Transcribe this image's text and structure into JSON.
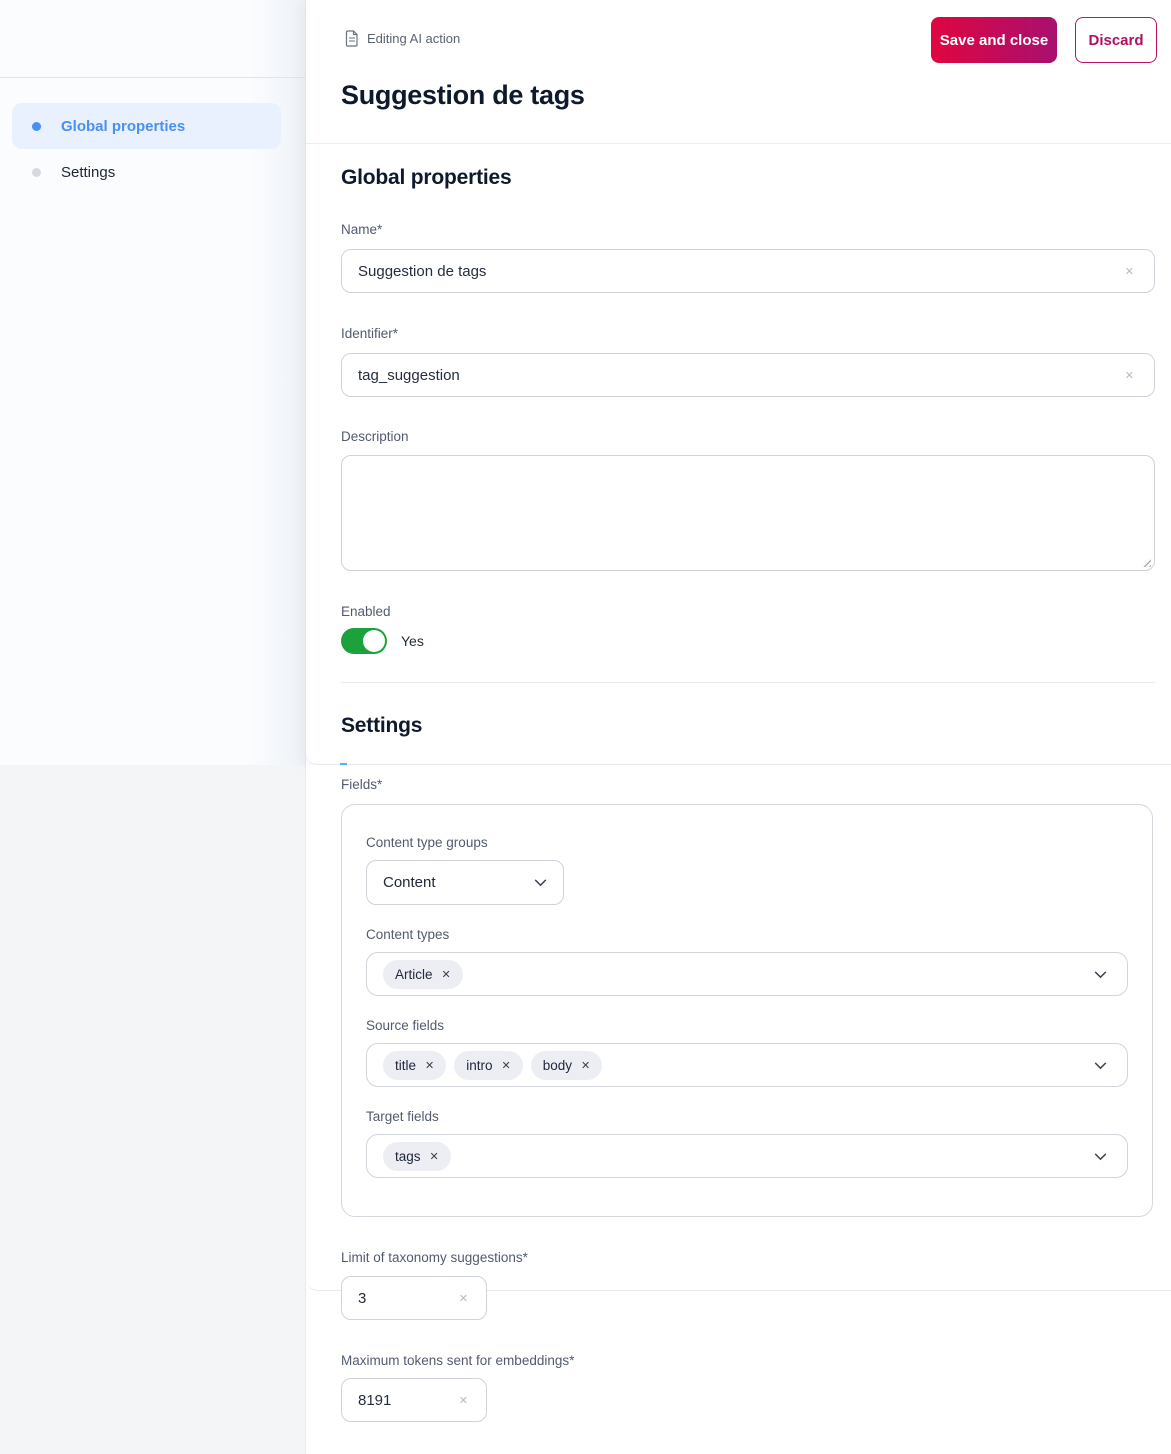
{
  "colors": {
    "accent_blue": "#4a90f2",
    "brand_gradient_start": "#e00540",
    "brand_gradient_end": "#a81070",
    "discard_crimson": "#b01060",
    "toggle_green": "#1ba23c",
    "active_nav_bg": "#e8f1fd",
    "pill_bg": "#edeef4"
  },
  "icons": {
    "clear": "✕",
    "remove_tag": "✕"
  },
  "sidebar": {
    "items": [
      {
        "label": "Global properties",
        "active": true
      },
      {
        "label": "Settings",
        "active": false
      }
    ]
  },
  "header": {
    "context_label": "Editing AI action",
    "save_label": "Save and close",
    "discard_label": "Discard"
  },
  "page": {
    "title": "Suggestion de tags"
  },
  "global_properties": {
    "heading": "Global properties",
    "name": {
      "label": "Name*",
      "value": "Suggestion de tags"
    },
    "identifier": {
      "label": "Identifier*",
      "value": "tag_suggestion"
    },
    "description": {
      "label": "Description",
      "value": ""
    },
    "enabled": {
      "label": "Enabled",
      "state_label": "Yes",
      "on": true
    }
  },
  "settings": {
    "heading": "Settings",
    "fields_label": "Fields*",
    "content_type_groups": {
      "label": "Content type groups",
      "selected": "Content"
    },
    "content_types": {
      "label": "Content types",
      "tags": [
        "Article"
      ]
    },
    "source_fields": {
      "label": "Source fields",
      "tags": [
        "title",
        "intro",
        "body"
      ]
    },
    "target_fields": {
      "label": "Target fields",
      "tags": [
        "tags"
      ]
    },
    "limit": {
      "label": "Limit of taxonomy suggestions*",
      "value": "3"
    },
    "max_tokens": {
      "label": "Maximum tokens sent for embeddings*",
      "value": "8191"
    }
  }
}
